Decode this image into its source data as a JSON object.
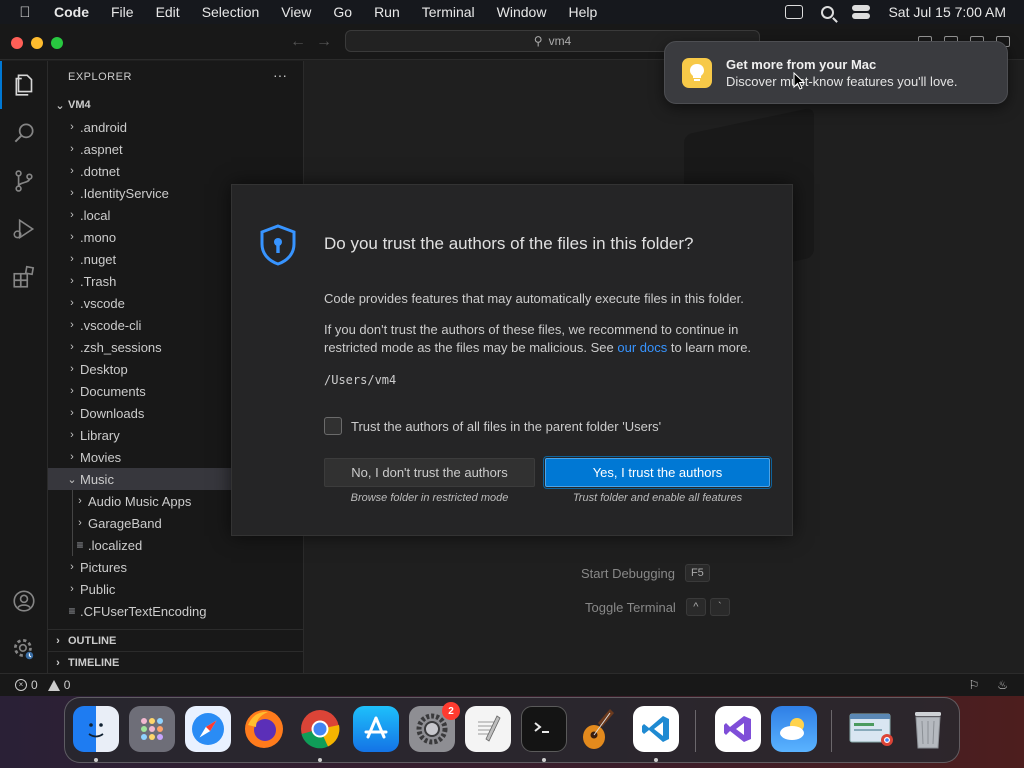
{
  "menubar": {
    "app": "Code",
    "items": [
      "File",
      "Edit",
      "Selection",
      "View",
      "Go",
      "Run",
      "Terminal",
      "Window",
      "Help"
    ],
    "clock": "Sat Jul 15  7:00 AM"
  },
  "titlebar": {
    "search": "vm4"
  },
  "explorer": {
    "header": "EXPLORER",
    "more": "···",
    "root": "VM4",
    "items": [
      {
        "label": ".android"
      },
      {
        "label": ".aspnet"
      },
      {
        "label": ".dotnet"
      },
      {
        "label": ".IdentityService"
      },
      {
        "label": ".local"
      },
      {
        "label": ".mono"
      },
      {
        "label": ".nuget"
      },
      {
        "label": ".Trash"
      },
      {
        "label": ".vscode"
      },
      {
        "label": ".vscode-cli"
      },
      {
        "label": ".zsh_sessions"
      },
      {
        "label": "Desktop"
      },
      {
        "label": "Documents"
      },
      {
        "label": "Downloads"
      },
      {
        "label": "Library"
      },
      {
        "label": "Movies"
      },
      {
        "label": "Music"
      },
      {
        "label": "Audio Music Apps"
      },
      {
        "label": "GarageBand"
      },
      {
        "label": ".localized"
      },
      {
        "label": "Pictures"
      },
      {
        "label": "Public"
      },
      {
        "label": ".CFUserTextEncoding"
      }
    ],
    "outline": "OUTLINE",
    "timeline": "TIMELINE"
  },
  "editor": {
    "shortcuts": [
      {
        "label": "Start Debugging",
        "key": "F5"
      },
      {
        "label": "Toggle Terminal",
        "key1": "^",
        "key2": "`"
      }
    ]
  },
  "dialog": {
    "title": "Do you trust the authors of the files in this folder?",
    "p1": "Code provides features that may automatically execute files in this folder.",
    "p2_before": "If you don't trust the authors of these files, we recommend to continue in restricted mode as the files may be malicious. See ",
    "p2_link": "our docs",
    "p2_after": " to learn more.",
    "path": "/Users/vm4",
    "checkbox_label": "Trust the authors of all files in the parent folder 'Users'",
    "no_button": "No, I don't trust the authors",
    "no_sub": "Browse folder in restricted mode",
    "yes_button": "Yes, I trust the authors",
    "yes_sub": "Trust folder and enable all features"
  },
  "notification": {
    "title": "Get more from your Mac",
    "body": "Discover must-know features you'll love."
  },
  "statusbar": {
    "errors": "0",
    "warnings": "0"
  },
  "dock": {
    "settings_badge": "2"
  },
  "colors": {
    "accent": "#0078d4",
    "link": "#3794ff",
    "badge": "#ff3b30"
  }
}
